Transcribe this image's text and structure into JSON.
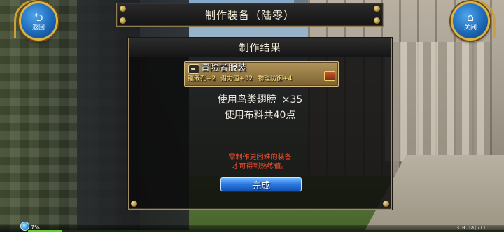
{
  "title_bar": {
    "title": "制作装备（陆零）"
  },
  "buttons": {
    "back_label": "返回",
    "close_label": "关闭"
  },
  "dialog": {
    "header": "制作结果",
    "item": {
      "name": "冒险者服装",
      "stats": [
        "镶嵌孔+2",
        "潜力值+32",
        "物理防御+4"
      ]
    },
    "material_line": "使用鸟类翅膀",
    "material_qty": "×35",
    "cloth_line": "使用布料共40点",
    "warning_lines": [
      "需制作更困难的装备",
      "才可得到熟练值。"
    ],
    "confirm_label": "完成"
  },
  "hud": {
    "percent": "7%",
    "exp_fraction": 0.07,
    "version": "3.0.1a(71)"
  },
  "colors": {
    "accent_gold": "#c9a23d",
    "button_blue": "#2a78e0",
    "warning_red": "#f05030",
    "stat_yellow": "#ffe88a"
  },
  "icons": {
    "back": "return-arrow-icon",
    "close": "house-icon",
    "item": "armor-icon",
    "chest": "treasure-chest-icon",
    "network": "globe-icon"
  }
}
